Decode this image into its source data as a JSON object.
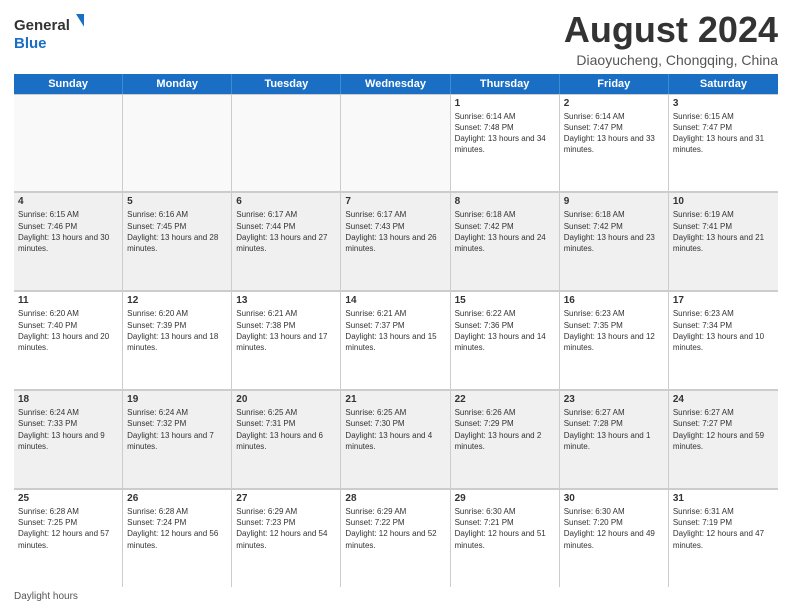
{
  "header": {
    "logo_general": "General",
    "logo_blue": "Blue",
    "title": "August 2024",
    "subtitle": "Diaoyucheng, Chongqing, China"
  },
  "days": [
    "Sunday",
    "Monday",
    "Tuesday",
    "Wednesday",
    "Thursday",
    "Friday",
    "Saturday"
  ],
  "footer": {
    "daylight_label": "Daylight hours"
  },
  "weeks": [
    [
      {
        "day": "",
        "content": ""
      },
      {
        "day": "",
        "content": ""
      },
      {
        "day": "",
        "content": ""
      },
      {
        "day": "",
        "content": ""
      },
      {
        "day": "1",
        "content": "Sunrise: 6:14 AM\nSunset: 7:48 PM\nDaylight: 13 hours and 34 minutes."
      },
      {
        "day": "2",
        "content": "Sunrise: 6:14 AM\nSunset: 7:47 PM\nDaylight: 13 hours and 33 minutes."
      },
      {
        "day": "3",
        "content": "Sunrise: 6:15 AM\nSunset: 7:47 PM\nDaylight: 13 hours and 31 minutes."
      }
    ],
    [
      {
        "day": "4",
        "content": "Sunrise: 6:15 AM\nSunset: 7:46 PM\nDaylight: 13 hours and 30 minutes."
      },
      {
        "day": "5",
        "content": "Sunrise: 6:16 AM\nSunset: 7:45 PM\nDaylight: 13 hours and 28 minutes."
      },
      {
        "day": "6",
        "content": "Sunrise: 6:17 AM\nSunset: 7:44 PM\nDaylight: 13 hours and 27 minutes."
      },
      {
        "day": "7",
        "content": "Sunrise: 6:17 AM\nSunset: 7:43 PM\nDaylight: 13 hours and 26 minutes."
      },
      {
        "day": "8",
        "content": "Sunrise: 6:18 AM\nSunset: 7:42 PM\nDaylight: 13 hours and 24 minutes."
      },
      {
        "day": "9",
        "content": "Sunrise: 6:18 AM\nSunset: 7:42 PM\nDaylight: 13 hours and 23 minutes."
      },
      {
        "day": "10",
        "content": "Sunrise: 6:19 AM\nSunset: 7:41 PM\nDaylight: 13 hours and 21 minutes."
      }
    ],
    [
      {
        "day": "11",
        "content": "Sunrise: 6:20 AM\nSunset: 7:40 PM\nDaylight: 13 hours and 20 minutes."
      },
      {
        "day": "12",
        "content": "Sunrise: 6:20 AM\nSunset: 7:39 PM\nDaylight: 13 hours and 18 minutes."
      },
      {
        "day": "13",
        "content": "Sunrise: 6:21 AM\nSunset: 7:38 PM\nDaylight: 13 hours and 17 minutes."
      },
      {
        "day": "14",
        "content": "Sunrise: 6:21 AM\nSunset: 7:37 PM\nDaylight: 13 hours and 15 minutes."
      },
      {
        "day": "15",
        "content": "Sunrise: 6:22 AM\nSunset: 7:36 PM\nDaylight: 13 hours and 14 minutes."
      },
      {
        "day": "16",
        "content": "Sunrise: 6:23 AM\nSunset: 7:35 PM\nDaylight: 13 hours and 12 minutes."
      },
      {
        "day": "17",
        "content": "Sunrise: 6:23 AM\nSunset: 7:34 PM\nDaylight: 13 hours and 10 minutes."
      }
    ],
    [
      {
        "day": "18",
        "content": "Sunrise: 6:24 AM\nSunset: 7:33 PM\nDaylight: 13 hours and 9 minutes."
      },
      {
        "day": "19",
        "content": "Sunrise: 6:24 AM\nSunset: 7:32 PM\nDaylight: 13 hours and 7 minutes."
      },
      {
        "day": "20",
        "content": "Sunrise: 6:25 AM\nSunset: 7:31 PM\nDaylight: 13 hours and 6 minutes."
      },
      {
        "day": "21",
        "content": "Sunrise: 6:25 AM\nSunset: 7:30 PM\nDaylight: 13 hours and 4 minutes."
      },
      {
        "day": "22",
        "content": "Sunrise: 6:26 AM\nSunset: 7:29 PM\nDaylight: 13 hours and 2 minutes."
      },
      {
        "day": "23",
        "content": "Sunrise: 6:27 AM\nSunset: 7:28 PM\nDaylight: 13 hours and 1 minute."
      },
      {
        "day": "24",
        "content": "Sunrise: 6:27 AM\nSunset: 7:27 PM\nDaylight: 12 hours and 59 minutes."
      }
    ],
    [
      {
        "day": "25",
        "content": "Sunrise: 6:28 AM\nSunset: 7:25 PM\nDaylight: 12 hours and 57 minutes."
      },
      {
        "day": "26",
        "content": "Sunrise: 6:28 AM\nSunset: 7:24 PM\nDaylight: 12 hours and 56 minutes."
      },
      {
        "day": "27",
        "content": "Sunrise: 6:29 AM\nSunset: 7:23 PM\nDaylight: 12 hours and 54 minutes."
      },
      {
        "day": "28",
        "content": "Sunrise: 6:29 AM\nSunset: 7:22 PM\nDaylight: 12 hours and 52 minutes."
      },
      {
        "day": "29",
        "content": "Sunrise: 6:30 AM\nSunset: 7:21 PM\nDaylight: 12 hours and 51 minutes."
      },
      {
        "day": "30",
        "content": "Sunrise: 6:30 AM\nSunset: 7:20 PM\nDaylight: 12 hours and 49 minutes."
      },
      {
        "day": "31",
        "content": "Sunrise: 6:31 AM\nSunset: 7:19 PM\nDaylight: 12 hours and 47 minutes."
      }
    ]
  ]
}
